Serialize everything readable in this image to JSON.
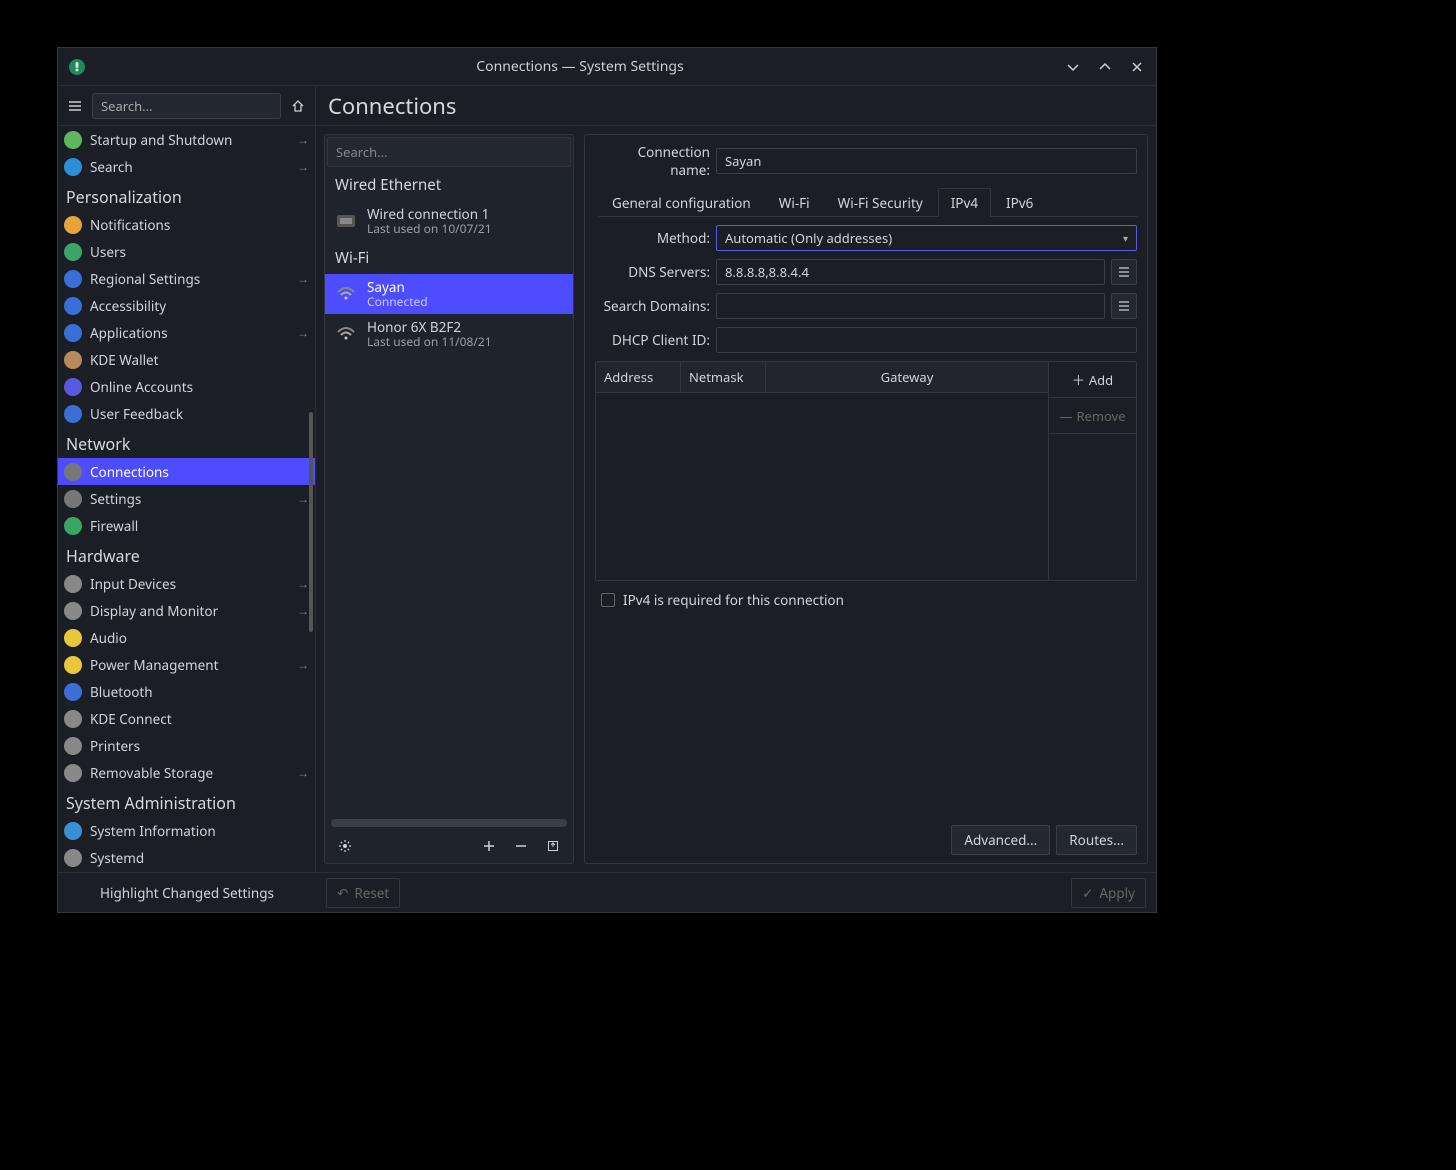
{
  "window": {
    "title": "Connections — System Settings"
  },
  "sidebar": {
    "search_placeholder": "Search…",
    "sections": [
      {
        "items": [
          {
            "icon": "startup",
            "color": "#5db85d",
            "label": "Startup and Shutdown",
            "arrow": true
          },
          {
            "icon": "search",
            "color": "#2a8fd8",
            "label": "Search",
            "arrow": true
          }
        ]
      },
      {
        "heading": "Personalization",
        "items": [
          {
            "icon": "bell",
            "color": "#e8a23a",
            "label": "Notifications"
          },
          {
            "icon": "user",
            "color": "#3aa566",
            "label": "Users"
          },
          {
            "icon": "region",
            "color": "#3a6fd8",
            "label": "Regional Settings",
            "arrow": true
          },
          {
            "icon": "access",
            "color": "#3a6fd8",
            "label": "Accessibility"
          },
          {
            "icon": "apps",
            "color": "#3a6fd8",
            "label": "Applications",
            "arrow": true
          },
          {
            "icon": "wallet",
            "color": "#b88a5a",
            "label": "KDE Wallet"
          },
          {
            "icon": "online",
            "color": "#5a5ae0",
            "label": "Online Accounts"
          },
          {
            "icon": "feedback",
            "color": "#3a6fd8",
            "label": "User Feedback"
          }
        ]
      },
      {
        "heading": "Network",
        "items": [
          {
            "icon": "net",
            "color": "#777",
            "label": "Connections",
            "active": true
          },
          {
            "icon": "netset",
            "color": "#777",
            "label": "Settings",
            "arrow": true
          },
          {
            "icon": "shield",
            "color": "#3aa566",
            "label": "Firewall"
          }
        ]
      },
      {
        "heading": "Hardware",
        "items": [
          {
            "icon": "mouse",
            "color": "#888",
            "label": "Input Devices",
            "arrow": true
          },
          {
            "icon": "monitor",
            "color": "#888",
            "label": "Display and Monitor",
            "arrow": true
          },
          {
            "icon": "audio",
            "color": "#e8c83a",
            "label": "Audio"
          },
          {
            "icon": "power",
            "color": "#e8c83a",
            "label": "Power Management",
            "arrow": true
          },
          {
            "icon": "bt",
            "color": "#3a6fd8",
            "label": "Bluetooth"
          },
          {
            "icon": "kdec",
            "color": "#888",
            "label": "KDE Connect"
          },
          {
            "icon": "print",
            "color": "#888",
            "label": "Printers"
          },
          {
            "icon": "usb",
            "color": "#888",
            "label": "Removable Storage",
            "arrow": true
          }
        ]
      },
      {
        "heading": "System Administration",
        "items": [
          {
            "icon": "info",
            "color": "#3a8fd8",
            "label": "System Information"
          },
          {
            "icon": "sysd",
            "color": "#888",
            "label": "Systemd"
          }
        ]
      }
    ]
  },
  "main": {
    "title": "Connections",
    "list_search_placeholder": "Search...",
    "groups": [
      {
        "title": "Wired Ethernet",
        "items": [
          {
            "icon": "eth",
            "name": "Wired connection 1",
            "sub": "Last used on 10/07/21"
          }
        ]
      },
      {
        "title": "Wi-Fi",
        "items": [
          {
            "icon": "wifi",
            "name": "Sayan",
            "sub": "Connected",
            "selected": true
          },
          {
            "icon": "wifi",
            "name": "Honor 6X B2F2",
            "sub": "Last used on 11/08/21"
          }
        ]
      }
    ]
  },
  "detail": {
    "name_label": "Connection name:",
    "name_value": "Sayan",
    "tabs": [
      "General configuration",
      "Wi-Fi",
      "Wi-Fi Security",
      "IPv4",
      "IPv6"
    ],
    "active_tab": 3,
    "method_label": "Method:",
    "method_value": "Automatic (Only addresses)",
    "dns_label": "DNS Servers:",
    "dns_value": "8.8.8.8,8.8.4.4",
    "search_label": "Search Domains:",
    "search_value": "",
    "dhcp_label": "DHCP Client ID:",
    "dhcp_value": "",
    "table_headers": [
      "Address",
      "Netmask",
      "Gateway"
    ],
    "add_label": "Add",
    "remove_label": "Remove",
    "required_label": "IPv4 is required for this connection",
    "advanced_label": "Advanced...",
    "routes_label": "Routes..."
  },
  "footer": {
    "highlight": "Highlight Changed Settings",
    "reset": "Reset",
    "apply": "Apply"
  }
}
